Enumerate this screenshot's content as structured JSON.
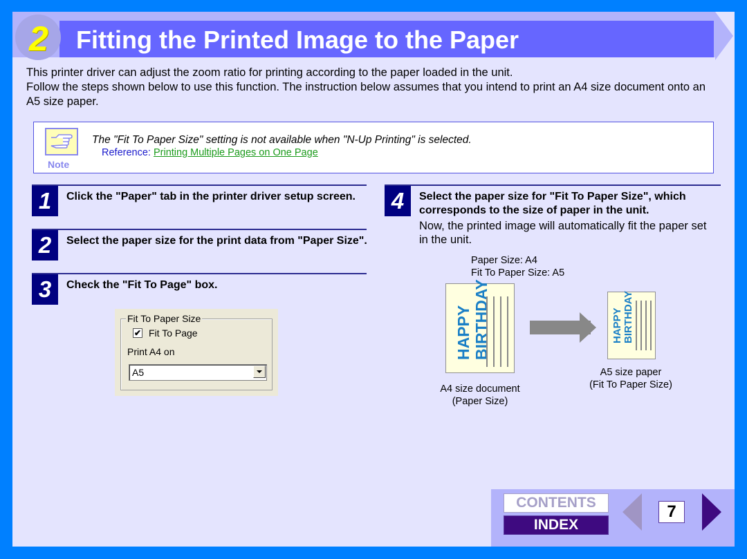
{
  "header": {
    "section_number": "2",
    "title": "Fitting the Printed Image to the Paper"
  },
  "intro": {
    "line1": "This printer driver can adjust the zoom ratio for printing according to the paper loaded in the unit.",
    "line2": "Follow the steps shown below to use this function. The instruction below assumes that you intend to print an A4 size document onto an A5 size paper."
  },
  "note": {
    "label": "Note",
    "icon": "pointing-hand-icon",
    "text": "The \"Fit To Paper Size\" setting is not available when \"N-Up Printing\" is selected.",
    "reference_prefix": "Reference: ",
    "reference_link": "Printing Multiple Pages on One Page"
  },
  "steps": [
    {
      "number": "1",
      "text": "Click the \"Paper\" tab in the printer driver setup screen."
    },
    {
      "number": "2",
      "text": "Select the paper size for the print data from \"Paper Size\"."
    },
    {
      "number": "3",
      "text": "Check the \"Fit To Page\" box."
    },
    {
      "number": "4",
      "text": "Select the paper size for \"Fit To Paper Size\", which corresponds to the size of paper in the unit.",
      "subtext": "Now, the printed image will automatically fit the paper set in the unit."
    }
  ],
  "dialog": {
    "group_label": "Fit To Paper Size",
    "checkbox_label": "Fit To Page",
    "checkbox_checked": true,
    "select_label": "Print A4 on",
    "select_value": "A5"
  },
  "illustration": {
    "paper_size_line": "Paper Size: A4",
    "fit_size_line": "Fit To Paper Size: A5",
    "doc_text_1": "HAPPY",
    "doc_text_2": "BIRTHDAY",
    "a4_caption_1": "A4 size document",
    "a4_caption_2": "(Paper Size)",
    "a5_caption_1": "A5 size paper",
    "a5_caption_2": "(Fit To Paper Size)"
  },
  "nav": {
    "contents_label": "CONTENTS",
    "index_label": "INDEX",
    "page_number": "7"
  },
  "colors": {
    "frame": "#0080ff",
    "title_bar": "#6666ff",
    "step_badge": "#000080",
    "link": "#1a9a1a",
    "accent_text": "#1a7fc6"
  }
}
